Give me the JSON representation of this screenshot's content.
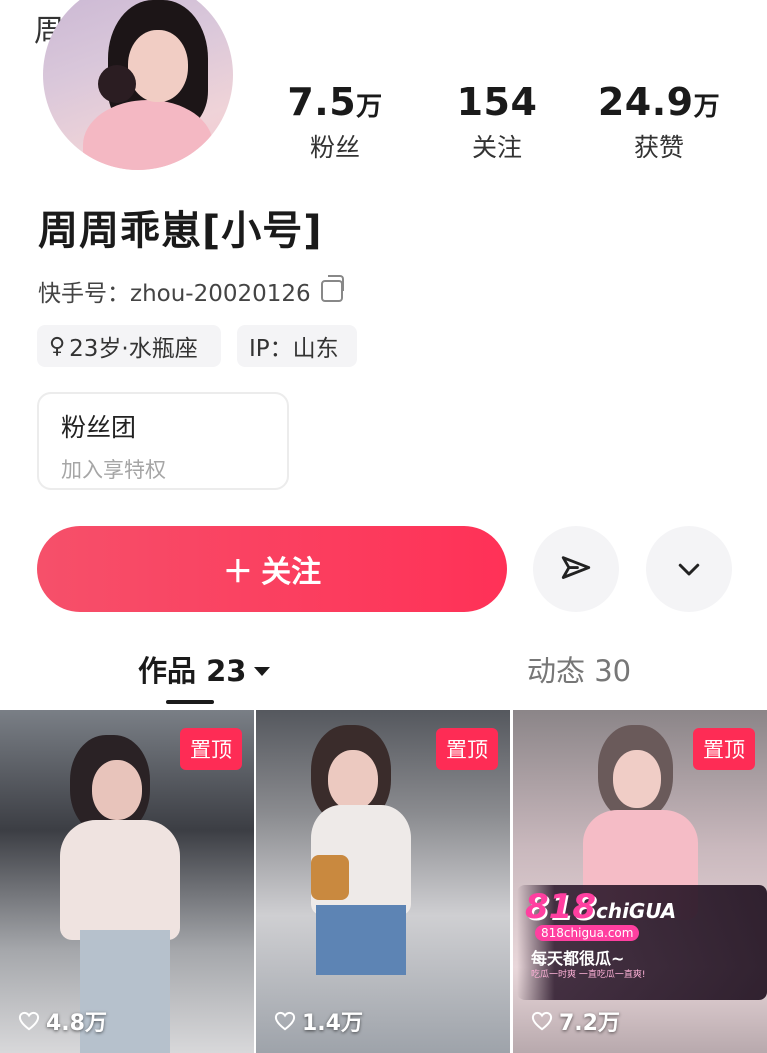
{
  "header": {
    "nickname_partial": "周",
    "avatar_icon": "user-avatar-photo"
  },
  "stats": [
    {
      "number": "7.5",
      "unit": "万",
      "label": "粉丝"
    },
    {
      "number": "154",
      "unit": "",
      "label": "关注"
    },
    {
      "number": "24.9",
      "unit": "万",
      "label": "获赞"
    }
  ],
  "profile": {
    "name": "周周乖崽[小号]",
    "kuaishou_id": "快手号：zhou-20020126",
    "tags": [
      {
        "icon": "female-gender-icon",
        "symbol": "♀",
        "text": "23岁·水瓶座"
      },
      {
        "icon": "",
        "symbol": "",
        "text": "IP：山东"
      }
    ]
  },
  "fan_group": {
    "title": "粉丝团",
    "subtitle": "加入享特权"
  },
  "actions": {
    "follow_label": "＋ 关注",
    "share_icon": "paper-plane-icon",
    "more_icon": "chevron-down-icon"
  },
  "tabs": [
    {
      "label": "作品 23",
      "active": true
    },
    {
      "label": "动态 30",
      "active": false
    }
  ],
  "videos": [
    {
      "pinned_label": "置顶",
      "likes": "4.8万"
    },
    {
      "pinned_label": "置顶",
      "likes": "1.4万"
    },
    {
      "pinned_label": "置顶",
      "likes": "7.2万"
    }
  ],
  "ad": {
    "logo_main": "818",
    "logo_sub": "chiGUA",
    "url": "818chigua.com",
    "slogan": "每天都很瓜~",
    "sub": "吃瓜一时爽 一直吃瓜一直爽!"
  },
  "colors": {
    "accent": "#fe2c55",
    "follow_gradient_start": "#f6506a",
    "follow_gradient_end": "#ff3157"
  }
}
